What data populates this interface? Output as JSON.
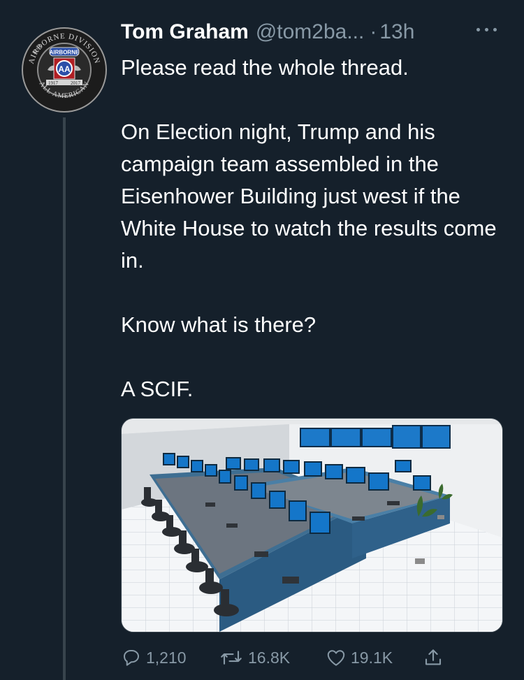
{
  "tweet": {
    "author_name": "Tom Graham",
    "handle": "@tom2ba...",
    "separator": "·",
    "time": "13h",
    "paragraphs": [
      "Please read the whole thread.",
      "On Election night, Trump and his campaign team assembled in the Eisenhower Building just west if the White House to watch the results come in.",
      "Know what is there?",
      "A SCIF."
    ],
    "media_icon": "control-room-photo"
  },
  "avatar": {
    "ring_top": "AIRBORNE DIVISION",
    "ring_bottom": "ALL AMERICAN",
    "prefix": "82ND",
    "tab": "AIRBORNE",
    "emblem": "AA",
    "year_left": "1917",
    "year_right": "2017"
  },
  "actions": {
    "reply": {
      "icon": "reply-icon",
      "count": "1,210"
    },
    "retweet": {
      "icon": "retweet-icon",
      "count": "16.8K"
    },
    "like": {
      "icon": "heart-icon",
      "count": "19.1K"
    },
    "share": {
      "icon": "share-icon"
    }
  },
  "colors": {
    "background": "#15202b",
    "secondary_text": "#8899a6",
    "divider": "#38444d",
    "primary_text": "#ffffff"
  }
}
